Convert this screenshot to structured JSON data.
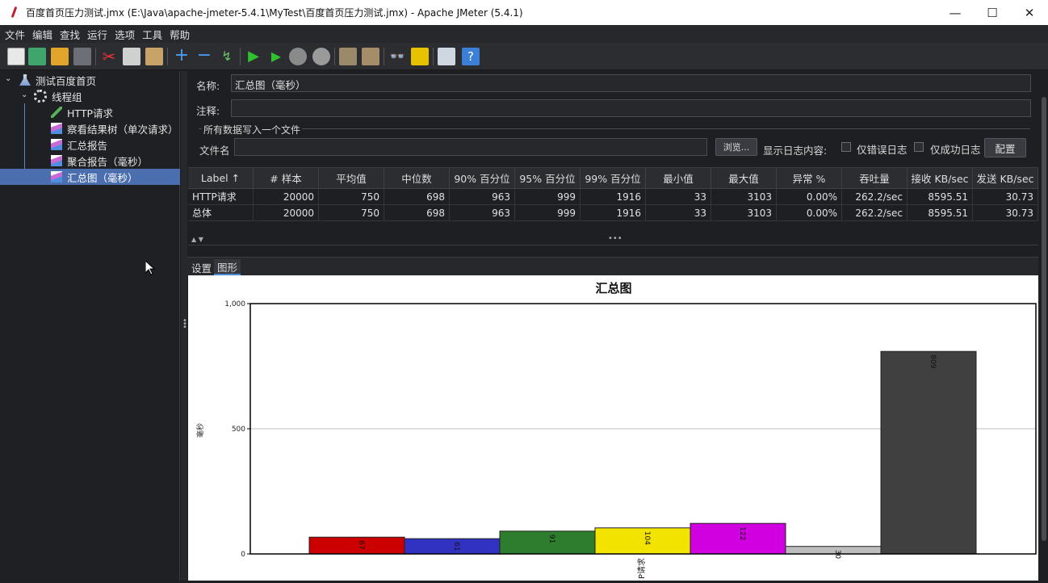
{
  "window": {
    "title": "百度首页压力测试.jmx (E:\\Java\\apache-jmeter-5.4.1\\MyTest\\百度首页压力测试.jmx) - Apache JMeter (5.4.1)",
    "minimize": "—",
    "maximize": "☐",
    "close": "✕"
  },
  "menu": [
    "文件",
    "编辑",
    "查找",
    "运行",
    "选项",
    "工具",
    "帮助"
  ],
  "tree": {
    "root": "测试百度首页",
    "thread_group": "线程组",
    "items": [
      "HTTP请求",
      "察看结果树（单次请求）",
      "汇总报告",
      "聚合报告（毫秒）",
      "汇总图（毫秒）"
    ]
  },
  "form": {
    "name_label": "名称:",
    "name_value": "汇总图（毫秒）",
    "comment_label": "注释:",
    "comment_value": "",
    "group_title": "所有数据写入一个文件",
    "file_label": "文件名",
    "file_value": "",
    "browse_label": "浏览...",
    "log_label": "显示日志内容:",
    "errors_only": "仅错误日志",
    "success_only": "仅成功日志",
    "config_label": "配置"
  },
  "table": {
    "headers": [
      "Label ↑",
      "# 样本",
      "平均值",
      "中位数",
      "90% 百分位",
      "95% 百分位",
      "99% 百分位",
      "最小值",
      "最大值",
      "异常 %",
      "吞吐量",
      "接收 KB/sec",
      "发送 KB/sec"
    ],
    "rows": [
      [
        "HTTP请求",
        "20000",
        "750",
        "698",
        "963",
        "999",
        "1916",
        "33",
        "3103",
        "0.00%",
        "262.2/sec",
        "8595.51",
        "30.73"
      ],
      [
        "总体",
        "20000",
        "750",
        "698",
        "963",
        "999",
        "1916",
        "33",
        "3103",
        "0.00%",
        "262.2/sec",
        "8595.51",
        "30.73"
      ]
    ]
  },
  "tabs": [
    "设置",
    "图形"
  ],
  "chart_data": {
    "type": "bar",
    "title": "汇总图",
    "ylabel": "毫秒",
    "ylim": [
      0,
      1000
    ],
    "yticks": [
      "1,000",
      "500",
      "0"
    ],
    "xlabel": "",
    "categories": [
      "P请求"
    ],
    "series": [
      {
        "name": "",
        "value": 67,
        "color": "#cc0000"
      },
      {
        "name": "",
        "value": 61,
        "color": "#3232c2"
      },
      {
        "name": "",
        "value": 91,
        "color": "#2e7d2e"
      },
      {
        "name": "",
        "value": 104,
        "color": "#f2e400"
      },
      {
        "name": "",
        "value": 122,
        "color": "#d000e0"
      },
      {
        "name": "",
        "value": 30,
        "color": "#bdbdbd"
      },
      {
        "name": "",
        "value": 809,
        "color": "#404040"
      }
    ],
    "grid": true
  }
}
